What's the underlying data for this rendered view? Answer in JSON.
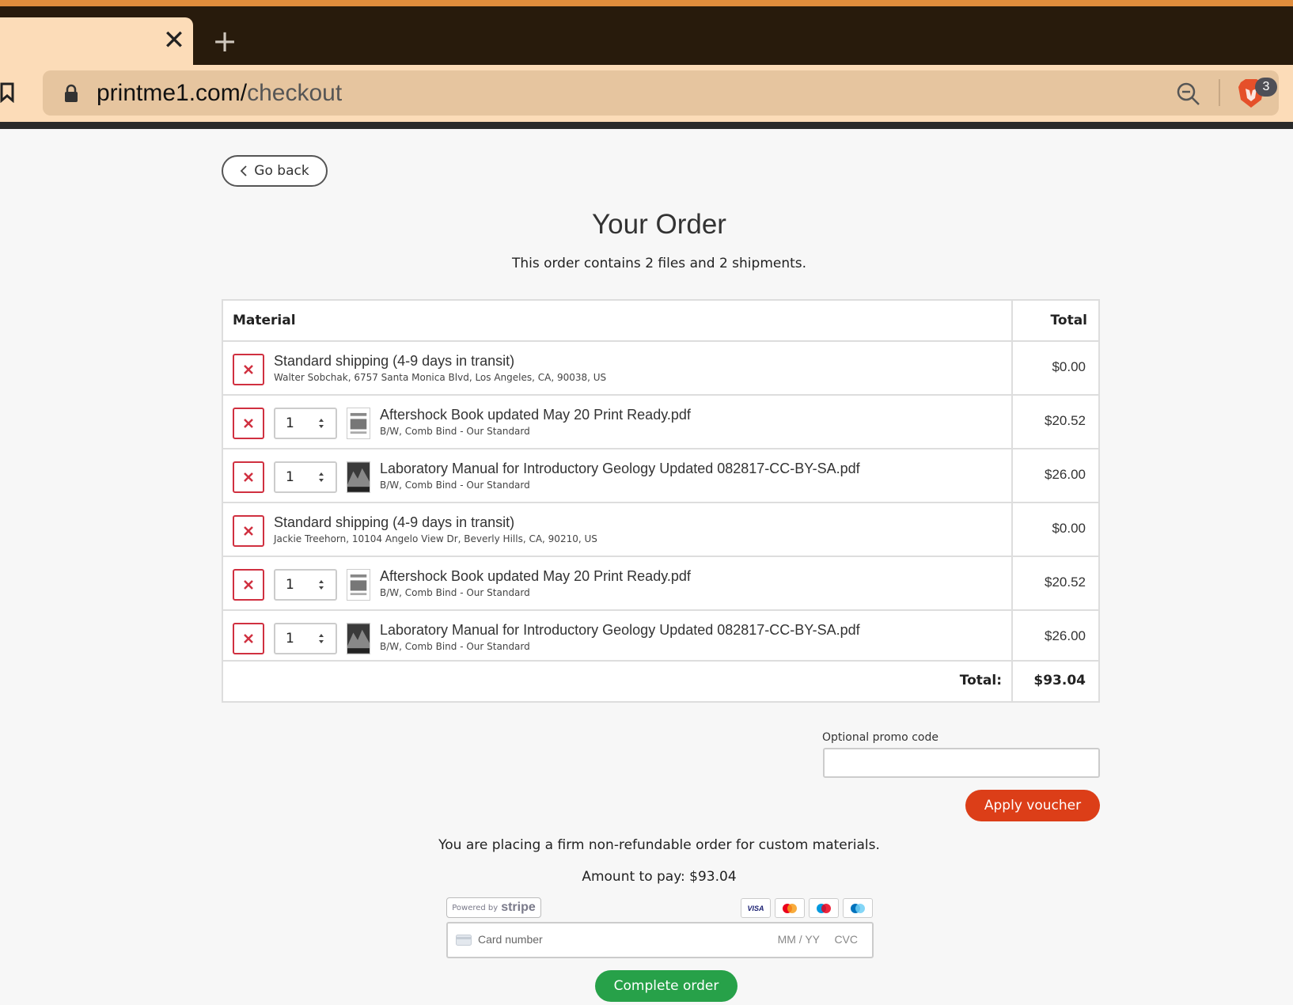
{
  "browser": {
    "url_host": "printme1.com/",
    "url_path": "checkout",
    "extension_badge": "3",
    "new_tab_symbol": "+",
    "tab_close_symbol": "✕"
  },
  "page": {
    "back_label": "Go back",
    "title": "Your Order",
    "subtitle": "This order contains 2 files and 2 shipments."
  },
  "table": {
    "headers": {
      "material": "Material",
      "total": "Total"
    },
    "rows": [
      {
        "type": "shipping",
        "title": "Standard shipping (4-9 days in transit)",
        "subtitle": "Walter Sobchak, 6757 Santa Monica Blvd, Los Angeles, CA, 90038, US",
        "price": "$0.00"
      },
      {
        "type": "file",
        "quantity": "1",
        "title": "Aftershock Book updated May 20 Print Ready.pdf",
        "subtitle": "B/W, Comb Bind - Our Standard",
        "price": "$20.52"
      },
      {
        "type": "file",
        "quantity": "1",
        "title": "Laboratory Manual for Introductory Geology Updated 082817-CC-BY-SA.pdf",
        "subtitle": "B/W, Comb Bind - Our Standard",
        "price": "$26.00"
      },
      {
        "type": "shipping",
        "title": "Standard shipping (4-9 days in transit)",
        "subtitle": "Jackie Treehorn, 10104 Angelo View Dr, Beverly Hills, CA, 90210, US",
        "price": "$0.00"
      },
      {
        "type": "file",
        "quantity": "1",
        "title": "Aftershock Book updated May 20 Print Ready.pdf",
        "subtitle": "B/W, Comb Bind - Our Standard",
        "price": "$20.52"
      },
      {
        "type": "file",
        "quantity": "1",
        "title": "Laboratory Manual for Introductory Geology Updated 082817-CC-BY-SA.pdf",
        "subtitle": "B/W, Comb Bind - Our Standard",
        "price": "$26.00"
      }
    ],
    "total_label": "Total:",
    "total_value": "$93.04"
  },
  "promo": {
    "label": "Optional promo code",
    "value": "",
    "apply_label": "Apply voucher"
  },
  "payment": {
    "warning": "You are placing a firm non-refundable order for custom materials.",
    "amount": "Amount to pay: $93.04",
    "stripe_powered": "Powered by",
    "stripe_name": "stripe",
    "card_brands": [
      "VISA",
      "Mastercard",
      "Maestro",
      "Cirrus"
    ],
    "card_placeholder": "Card number",
    "expiry_placeholder": "MM / YY",
    "cvc_placeholder": "CVC",
    "complete_label": "Complete order"
  },
  "colors": {
    "accent_orange": "#dc3e18",
    "accent_green": "#27a149",
    "remove_red": "#d03040",
    "browser_tab": "#fcdcb8"
  }
}
